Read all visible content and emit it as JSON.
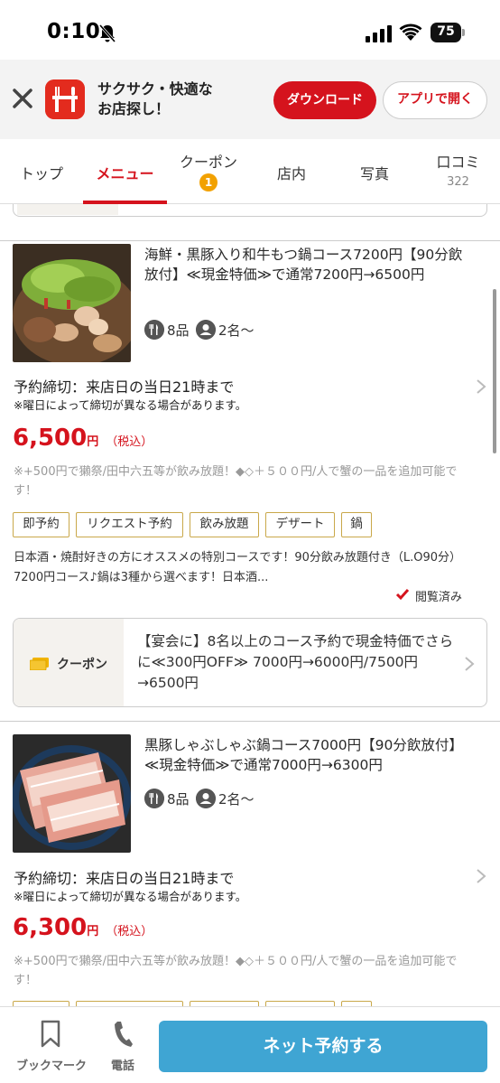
{
  "status": {
    "time": "0:10",
    "battery": "75"
  },
  "banner": {
    "line1": "サクサク・快適な",
    "line2": "お店探し！",
    "download_label": "ダウンロード",
    "open_app_label": "アプリで開く"
  },
  "tabs": [
    {
      "label": "トップ"
    },
    {
      "label": "メニュー",
      "active": true
    },
    {
      "label": "クーポン",
      "badge": "1"
    },
    {
      "label": "店内"
    },
    {
      "label": "写真"
    },
    {
      "label": "口コミ",
      "count": "322"
    }
  ],
  "courses": [
    {
      "title": "海鮮・黒豚入り和牛もつ鍋コース7200円【90分飲放付】≪現金特価≫で通常7200円→6500円",
      "items": "8品",
      "people": "2名〜",
      "deadline": "予約締切：来店日の当日21時まで",
      "deadline_note": "※曜日によって締切が異なる場合があります。",
      "price": "6,500",
      "yen": "円",
      "tax": "（税込）",
      "note": "※+500円で獺祭/田中六五等が飲み放題！◆◇＋５００円/人で蟹の一品を追加可能です！",
      "tags": [
        "即予約",
        "リクエスト予約",
        "飲み放題",
        "デザート",
        "鍋"
      ],
      "description": "日本酒・焼酎好きの方にオススメの特別コースです！90分飲み放題付き（L.O90分）7200円コース♪鍋は3種から選べます！日本酒...",
      "viewed": "閲覧済み"
    },
    {
      "title": "黒豚しゃぶしゃぶ鍋コース7000円【90分飲放付】≪現金特価≫で通常7000円→6300円",
      "items": "8品",
      "people": "2名〜",
      "deadline": "予約締切：来店日の当日21時まで",
      "deadline_note": "※曜日によって締切が異なる場合があります。",
      "price": "6,300",
      "yen": "円",
      "tax": "（税込）",
      "note": "※+500円で獺祭/田中六五等が飲み放題！◆◇＋５００円/人で蟹の一品を追加可能です！"
    }
  ],
  "coupon": {
    "label": "クーポン",
    "text": "【宴会に】8名以上のコース予約で現金特価でさらに≪300円OFF≫ 7000円→6000円/7500円→6500円"
  },
  "bottom": {
    "bookmark_label": "ブックマーク",
    "tel_label": "電話",
    "reserve_label": "ネット予約する"
  },
  "colors": {
    "brand_red": "#d5131d",
    "reserve_blue": "#3fa5d3",
    "tag_border": "#c9a84a",
    "badge_orange": "#f2a100"
  }
}
